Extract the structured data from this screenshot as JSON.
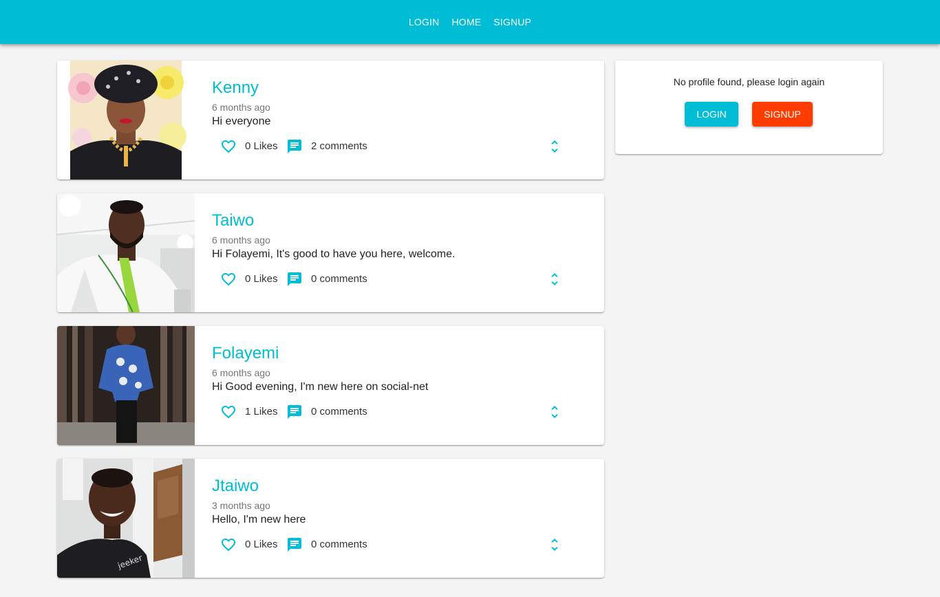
{
  "nav": {
    "items": [
      {
        "label": "LOGIN"
      },
      {
        "label": "HOME"
      },
      {
        "label": "SIGNUP"
      }
    ]
  },
  "colors": {
    "primary": "#00bcd4",
    "secondary": "#ff3d00"
  },
  "screams": [
    {
      "user_handle": "Kenny",
      "created_at": "6 months ago",
      "body": "Hi everyone",
      "likes": "0 Likes",
      "comments": "2 comments"
    },
    {
      "user_handle": "Taiwo",
      "created_at": "6 months ago",
      "body": "Hi Folayemi, It's good to have you here, welcome.",
      "likes": "0 Likes",
      "comments": "0 comments"
    },
    {
      "user_handle": "Folayemi",
      "created_at": "6 months ago",
      "body": "Hi Good evening, I'm new here on social-net",
      "likes": "1 Likes",
      "comments": "0 comments"
    },
    {
      "user_handle": "Jtaiwo",
      "created_at": "3 months ago",
      "body": "Hello, I'm new here",
      "likes": "0 Likes",
      "comments": "0 comments"
    }
  ],
  "profile": {
    "message": "No profile found, please login again",
    "login_label": "LOGIN",
    "signup_label": "SIGNUP"
  }
}
